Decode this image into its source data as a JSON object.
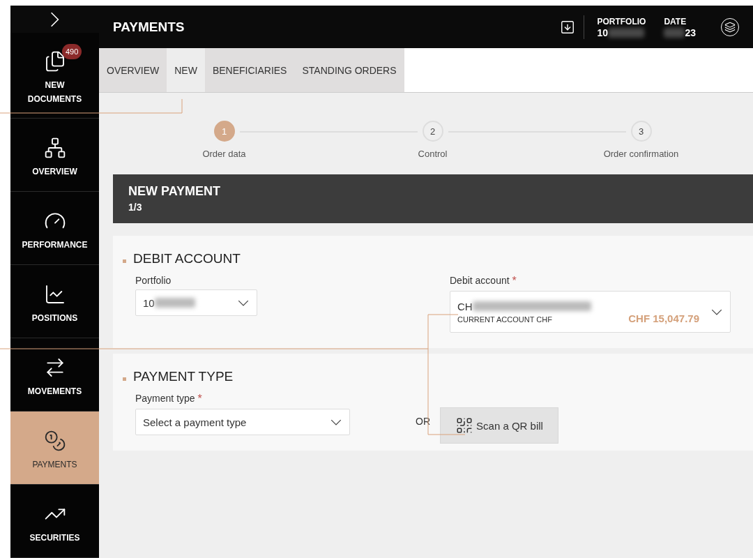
{
  "sidebar": {
    "items": [
      {
        "label": "NEW DOCUMENTS",
        "kind": "documents",
        "badge": "490",
        "selected": false
      },
      {
        "label": "OVERVIEW",
        "kind": "network",
        "selected": false
      },
      {
        "label": "PERFORMANCE",
        "kind": "gauge",
        "selected": false
      },
      {
        "label": "POSITIONS",
        "kind": "chart",
        "selected": false
      },
      {
        "label": "MOVEMENTS",
        "kind": "arrows",
        "selected": false
      },
      {
        "label": "PAYMENTS",
        "kind": "coins",
        "selected": true
      },
      {
        "label": "SECURITIES",
        "kind": "trend",
        "selected": false
      }
    ]
  },
  "header": {
    "title": "PAYMENTS",
    "portfolio": {
      "label": "PORTFOLIO",
      "value": "10"
    },
    "date": {
      "label": "DATE",
      "value": "23"
    }
  },
  "tabs": [
    {
      "label": "OVERVIEW",
      "selected": false
    },
    {
      "label": "NEW",
      "selected": true
    },
    {
      "label": "BENEFICIARIES",
      "selected": false
    },
    {
      "label": "STANDING ORDERS",
      "selected": false
    }
  ],
  "stepper": [
    {
      "number": "1",
      "label": "Order data",
      "selected": true
    },
    {
      "number": "2",
      "label": "Control",
      "selected": false
    },
    {
      "number": "3",
      "label": "Order confirmation",
      "selected": false
    }
  ],
  "panel": {
    "title": "NEW PAYMENT",
    "step": "1/3"
  },
  "debit_section": {
    "title": "DEBIT ACCOUNT",
    "portfolio": {
      "label": "Portfolio",
      "value": "10"
    },
    "debit_account": {
      "label": "Debit account",
      "required_mark": "*",
      "value": "CH",
      "account_type": "CURRENT ACCOUNT CHF",
      "balance": "CHF 15,047.79"
    }
  },
  "payment_section": {
    "title": "PAYMENT TYPE",
    "payment_type": {
      "label": "Payment type",
      "required_mark": "*",
      "placeholder": "Select a payment type"
    },
    "or": "OR",
    "qr_button": "Scan a QR bill"
  }
}
